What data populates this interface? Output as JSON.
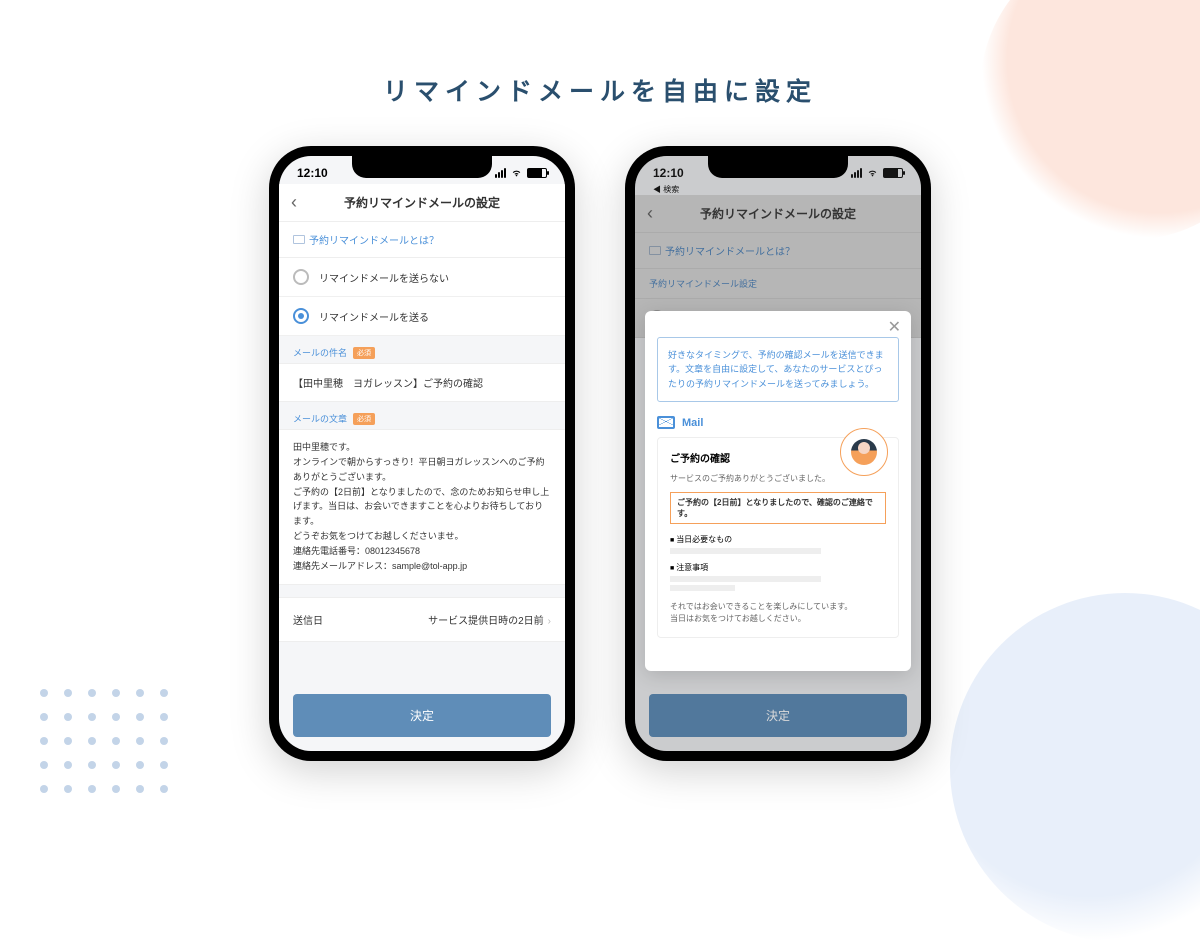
{
  "heading": "リマインドメールを自由に設定",
  "status": {
    "time": "12:10",
    "search_back": "◀ 検索"
  },
  "nav": {
    "title": "予約リマインドメールの設定"
  },
  "info_link": "予約リマインドメールとは？",
  "settings_sub": "予約リマインドメール設定",
  "radios": {
    "off": "リマインドメールを送らない",
    "on": "リマインドメールを送る"
  },
  "subject": {
    "label": "メールの件名",
    "badge": "必須",
    "value": "【田中里穂　ヨガレッスン】ご予約の確認"
  },
  "body": {
    "label": "メールの文章",
    "badge": "必須",
    "text": "田中里穂です。\nオンラインで朝からすっきり！平日朝ヨガレッスンへのご予約ありがとうございます。\nご予約の【2日前】となりましたので、念のためお知らせ申し上げます。当日は、お会いできますことを心よりお待ちしております。\nどうぞお気をつけてお越しくださいませ。\n連絡先電話番号：08012345678\n連絡先メールアドレス：sample@tol-app.jp"
  },
  "send_date": {
    "label": "送信日",
    "value": "サービス提供日時の2日前"
  },
  "submit": "決定",
  "modal": {
    "intro": "好きなタイミングで、予約の確認メールを送信できます。文章を自由に設定して、あなたのサービスとぴったりの予約リマインドメールを送ってみましょう。",
    "mail_label": "Mail",
    "preview": {
      "title": "ご予約の確認",
      "subtitle": "サービスのご予約ありがとうございました。",
      "highlight": "ご予約の【2日前】となりましたので、確認のご連絡です。",
      "section1": "当日必要なもの",
      "section2": "注意事項",
      "footer": "それではお会いできることを楽しみにしています。\n当日はお気をつけてお越しください。"
    }
  }
}
